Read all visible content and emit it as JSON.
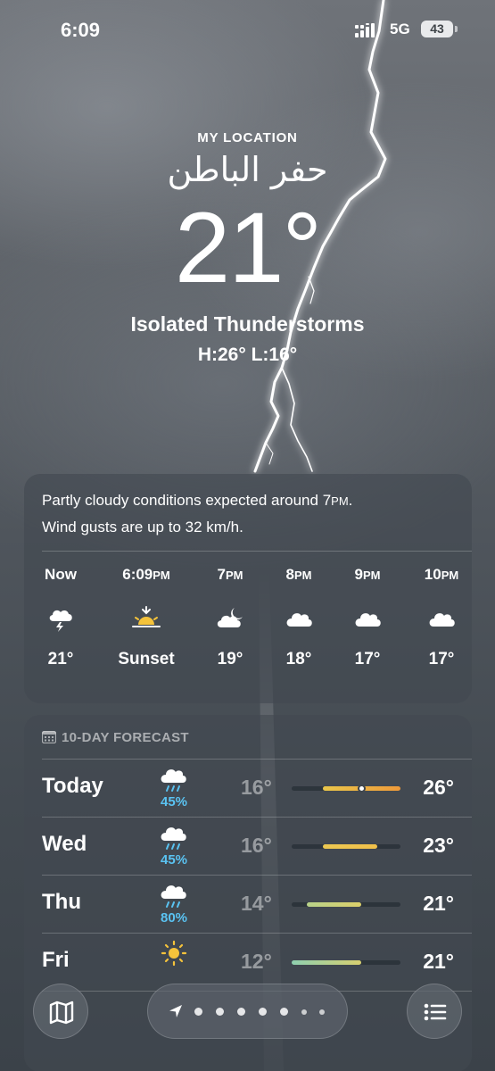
{
  "status_bar": {
    "time": "6:09",
    "network": "5G",
    "battery": "43"
  },
  "header": {
    "location_label": "MY LOCATION",
    "city": "حفر الباطن",
    "temperature": "21°",
    "condition": "Isolated Thunderstorms",
    "high_low": "H:26°  L:16°"
  },
  "hourly": {
    "summary_line1_a": "Partly cloudy conditions expected around 7",
    "summary_line1_b": "PM",
    "summary_line1_c": ".",
    "summary_line2": "Wind gusts are up to 32 km/h.",
    "hours": [
      {
        "label": "Now",
        "ampm": "",
        "icon": "thunderstorm-icon",
        "temp": "21°"
      },
      {
        "label": "6:09",
        "ampm": "PM",
        "icon": "sunset-icon",
        "temp": "Sunset"
      },
      {
        "label": "7",
        "ampm": "PM",
        "icon": "partly-cloudy-night-icon",
        "temp": "19°"
      },
      {
        "label": "8",
        "ampm": "PM",
        "icon": "cloud-icon",
        "temp": "18°"
      },
      {
        "label": "9",
        "ampm": "PM",
        "icon": "cloud-icon",
        "temp": "17°"
      },
      {
        "label": "10",
        "ampm": "PM",
        "icon": "cloud-icon",
        "temp": "17°"
      }
    ]
  },
  "forecast": {
    "title": "10-DAY FORECAST",
    "range_min": 12,
    "range_max": 26,
    "current_temp": 21,
    "days": [
      {
        "day": "Today",
        "icon": "rain-cloud-icon",
        "precip": "45%",
        "low": "16°",
        "high": "26°",
        "low_value": 16,
        "high_value": 26,
        "color_from": "#e9c64a",
        "color_to": "#ee9a3a",
        "current": true
      },
      {
        "day": "Wed",
        "icon": "rain-cloud-icon",
        "precip": "45%",
        "low": "16°",
        "high": "23°",
        "low_value": 16,
        "high_value": 23,
        "color_from": "#ecc852",
        "color_to": "#f1c04a",
        "current": false
      },
      {
        "day": "Thu",
        "icon": "rain-cloud-icon",
        "precip": "80%",
        "low": "14°",
        "high": "21°",
        "low_value": 14,
        "high_value": 21,
        "color_from": "#b8d28a",
        "color_to": "#dcd06a",
        "current": false
      },
      {
        "day": "Fri",
        "icon": "sun-icon",
        "precip": "",
        "low": "12°",
        "high": "21°",
        "low_value": 12,
        "high_value": 21,
        "color_from": "#8fd0b0",
        "color_to": "#d8d070",
        "current": false
      }
    ]
  },
  "colors": {
    "precip": "#5ac3f2",
    "sun": "#f5c33b",
    "card": "#424951"
  }
}
